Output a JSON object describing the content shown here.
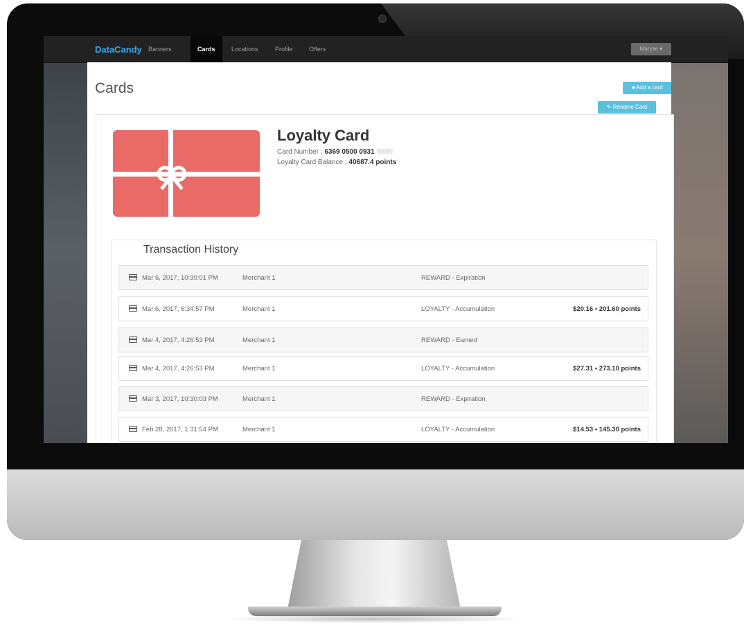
{
  "navbar": {
    "brand": "DataCandy",
    "links": [
      "Banners",
      "Cards",
      "Locations",
      "Profile",
      "Offers"
    ],
    "active": "Cards",
    "user": "Maryse ▾"
  },
  "page": {
    "title": "Cards",
    "add_button": "⊕Add a card",
    "rename_button": "✎ Rename Card"
  },
  "card": {
    "title": "Loyalty Card",
    "number_label": "Card Number : ",
    "number": "6369 0500 0931",
    "number_masked": "8699",
    "balance_label": "Loyalty Card Balance : ",
    "balance": "40687.4 points"
  },
  "history": {
    "title": "Transaction History",
    "rows": [
      {
        "date": "Mar 6, 2017, 10:30:01 PM",
        "merchant": "Merchant 1",
        "type": "REWARD - Expiration",
        "amount": ""
      },
      {
        "date": "Mar 6, 2017, 6:34:57 PM",
        "merchant": "Merchant 1",
        "type": "LOYALTY - Accumulation",
        "amount": "$20.16 • 201.60 points"
      },
      {
        "date": "Mar 4, 2017, 4:26:53 PM",
        "merchant": "Merchant 1",
        "type": "REWARD - Earned",
        "amount": ""
      },
      {
        "date": "Mar 4, 2017, 4:26:53 PM",
        "merchant": "Merchant 1",
        "type": "LOYALTY - Accumulation",
        "amount": "$27.31 • 273.10 points"
      },
      {
        "date": "Mar 3, 2017, 10:30:03 PM",
        "merchant": "Merchant 1",
        "type": "REWARD - Expiration",
        "amount": ""
      },
      {
        "date": "Feb 28, 2017, 1:31:54 PM",
        "merchant": "Merchant 1",
        "type": "LOYALTY - Accumulation",
        "amount": "$14.53 • 145.30 points"
      }
    ]
  },
  "colors": {
    "brand": "#3aa6e8",
    "button": "#5bc0de",
    "gift_card": "#e96a66",
    "navbar": "#222222"
  }
}
